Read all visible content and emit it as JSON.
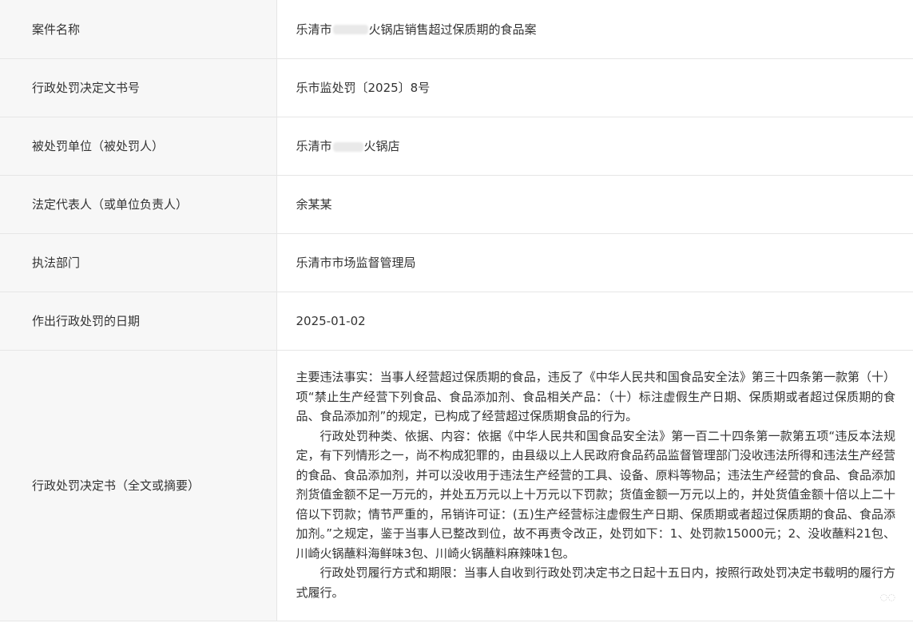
{
  "rows": [
    {
      "label": "案件名称",
      "value_prefix": "乐清市",
      "value_suffix": "火锅店销售超过保质期的食品案"
    },
    {
      "label": "行政处罚决定文书号",
      "value": "乐市监处罚〔2025〕8号"
    },
    {
      "label": "被处罚单位（被处罚人）",
      "value_prefix": "乐清市",
      "value_suffix": "火锅店"
    },
    {
      "label": "法定代表人（或单位负责人）",
      "value": "余某某"
    },
    {
      "label": "执法部门",
      "value": "乐清市市场监督管理局"
    },
    {
      "label": "作出行政处罚的日期",
      "value": "2025-01-02"
    },
    {
      "label": "行政处罚决定书（全文或摘要）",
      "paragraphs": [
        "主要违法事实：当事人经营超过保质期的食品，违反了《中华人民共和国食品安全法》第三十四条第一款第（十）项“禁止生产经营下列食品、食品添加剂、食品相关产品：（十）标注虚假生产日期、保质期或者超过保质期的食品、食品添加剂”的规定，已构成了经营超过保质期食品的行为。",
        "行政处罚种类、依据、内容：依据《中华人民共和国食品安全法》第一百二十四条第一款第五项“违反本法规定，有下列情形之一，尚不构成犯罪的，由县级以上人民政府食品药品监督管理部门没收违法所得和违法生产经营的食品、食品添加剂，并可以没收用于违法生产经营的工具、设备、原料等物品；违法生产经营的食品、食品添加剂货值金额不足一万元的，并处五万元以上十万元以下罚款；货值金额一万元以上的，并处货值金额十倍以上二十倍以下罚款；情节严重的，吊销许可证：(五)生产经营标注虚假生产日期、保质期或者超过保质期的食品、食品添加剂。”之规定，鉴于当事人已整改到位，故不再责令改正，处罚如下：1、处罚款15000元；2、没收蘸料21包、川崎火锅蘸料海鲜味3包、川崎火锅蘸料麻辣味1包。",
        "行政处罚履行方式和期限：当事人自收到行政处罚决定书之日起十五日内，按照行政处罚决定书载明的履行方式履行。"
      ]
    }
  ]
}
